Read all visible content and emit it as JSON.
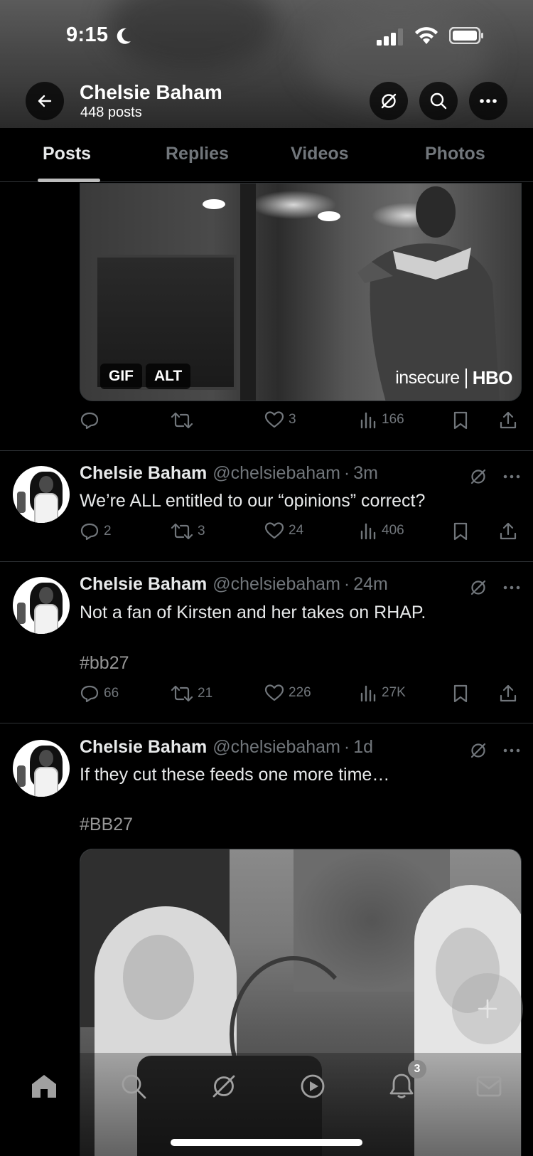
{
  "status_bar": {
    "time": "9:15"
  },
  "header": {
    "profile_name": "Chelsie Baham",
    "post_count": "448 posts"
  },
  "tabs": [
    {
      "label": "Posts",
      "active": true
    },
    {
      "label": "Replies",
      "active": false
    },
    {
      "label": "Videos",
      "active": false
    },
    {
      "label": "Photos",
      "active": false
    }
  ],
  "post1": {
    "media_badges": [
      "GIF",
      "ALT"
    ],
    "watermark_left": "insecure",
    "watermark_right": "HBO",
    "replies": "",
    "reposts": "",
    "likes": "3",
    "views": "166"
  },
  "post2": {
    "name": "Chelsie Baham",
    "handle": "@chelsiebaham",
    "time": "3m",
    "text": "We’re ALL entitled to our “opinions” correct?",
    "replies": "2",
    "reposts": "3",
    "likes": "24",
    "views": "406"
  },
  "post3": {
    "name": "Chelsie Baham",
    "handle": "@chelsiebaham",
    "time": "24m",
    "text": "Not a fan of Kirsten and her takes on RHAP.",
    "hashtag": "#bb27",
    "replies": "66",
    "reposts": "21",
    "likes": "226",
    "views": "27K"
  },
  "post4": {
    "name": "Chelsie Baham",
    "handle": "@chelsiebaham",
    "time": "1d",
    "text": "If they cut these feeds one more time…",
    "hashtag": "#BB27"
  },
  "bottom_nav": {
    "notifications_badge": "3"
  },
  "colors": {
    "background": "#000000",
    "text_primary": "#e7e9ea",
    "text_secondary": "#71767b",
    "divider": "#2f3336"
  }
}
